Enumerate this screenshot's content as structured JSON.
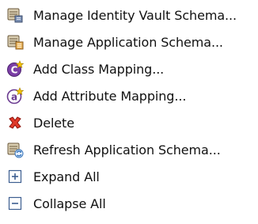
{
  "menu": {
    "items": [
      {
        "label": "Manage Identity Vault Schema...",
        "icon": "schema-scroll-icon"
      },
      {
        "label": "Manage Application Schema...",
        "icon": "schema-scroll-icon"
      },
      {
        "label": "Add Class Mapping...",
        "icon": "class-mapping-icon"
      },
      {
        "label": "Add Attribute Mapping...",
        "icon": "attribute-mapping-icon"
      },
      {
        "label": "Delete",
        "icon": "delete-x-icon"
      },
      {
        "label": "Refresh Application Schema...",
        "icon": "refresh-schema-icon"
      },
      {
        "label": "Expand All",
        "icon": "expand-all-icon"
      },
      {
        "label": "Collapse All",
        "icon": "collapse-all-icon"
      }
    ]
  }
}
